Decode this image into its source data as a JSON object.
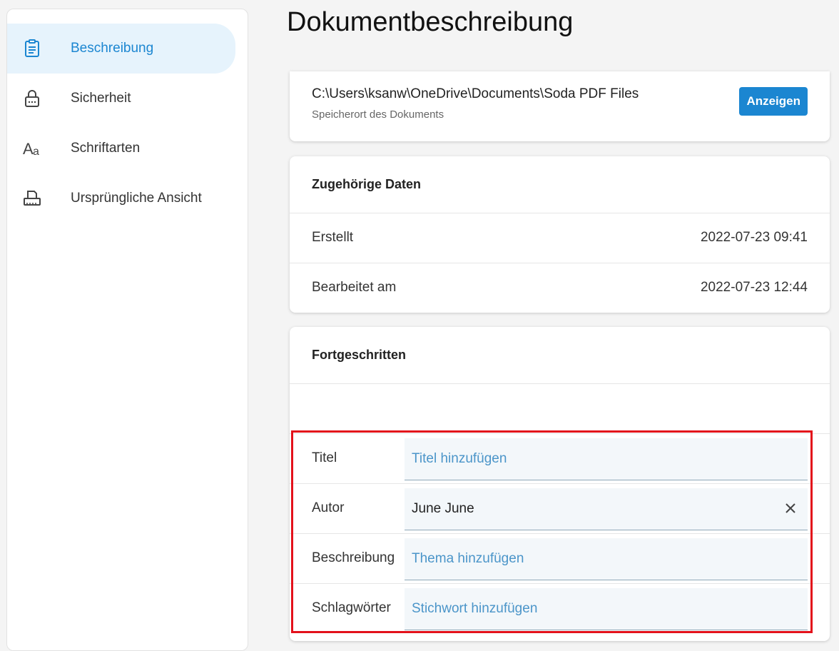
{
  "sidebar": {
    "items": [
      {
        "label": "Beschreibung",
        "icon": "clipboard-icon",
        "active": true
      },
      {
        "label": "Sicherheit",
        "icon": "lock-icon",
        "active": false
      },
      {
        "label": "Schriftarten",
        "icon": "font-icon",
        "active": false
      },
      {
        "label": "Ursprüngliche Ansicht",
        "icon": "printer-icon",
        "active": false
      }
    ]
  },
  "main": {
    "title": "Dokumentbeschreibung",
    "location": {
      "path": "C:\\Users\\ksanw\\OneDrive\\Documents\\Soda PDF Files",
      "caption": "Speicherort des Dokuments",
      "button_label": "Anzeigen"
    },
    "related": {
      "header": "Zugehörige Daten",
      "rows": [
        {
          "label": "Erstellt",
          "value": "2022-07-23 09:41"
        },
        {
          "label": "Bearbeitet am",
          "value": "2022-07-23 12:44"
        }
      ]
    },
    "advanced": {
      "header": "Fortgeschritten",
      "fields": [
        {
          "label": "Titel",
          "value": "",
          "placeholder": "Titel hinzufügen"
        },
        {
          "label": "Autor",
          "value": "June June",
          "placeholder": ""
        },
        {
          "label": "Beschreibung",
          "value": "",
          "placeholder": "Thema hinzufügen"
        },
        {
          "label": "Schlagwörter",
          "value": "",
          "placeholder": "Stichwort hinzufügen"
        }
      ]
    }
  },
  "colors": {
    "accent": "#1b86d1",
    "active_bg": "#e6f3fc",
    "highlight": "#e3111b"
  }
}
